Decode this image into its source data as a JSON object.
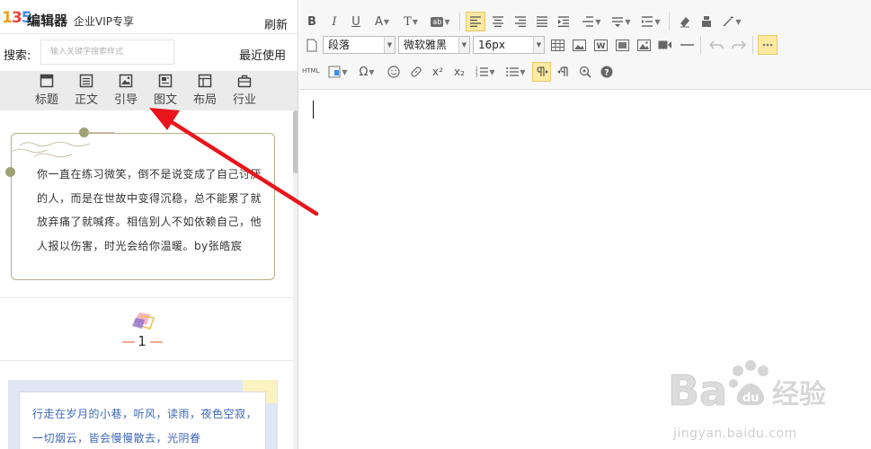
{
  "app": {
    "logo_digits": [
      "1",
      "3",
      "5"
    ],
    "title": "编辑器",
    "edition": "企业VIP专享",
    "refresh": "刷新"
  },
  "search": {
    "label": "搜索:",
    "placeholder": "输入关键字搜索样式",
    "recent": "最近使用"
  },
  "categories": [
    {
      "label": "标题",
      "icon": "title-icon"
    },
    {
      "label": "正文",
      "icon": "body-text-icon"
    },
    {
      "label": "引导",
      "icon": "image-guide-icon"
    },
    {
      "label": "图文",
      "icon": "image-text-icon"
    },
    {
      "label": "布局",
      "icon": "layout-icon"
    },
    {
      "label": "行业",
      "icon": "industry-icon"
    }
  ],
  "templates": {
    "card1_text": "你一直在练习微笑，倒不是说变成了自己讨厌的人，而是在世故中变得沉稳，总不能累了就放弃痛了就喊疼。相信别人不如依赖自己，他人报以伤害，时光会给你温暖。by张皓宸",
    "page_number": "1",
    "card2_text": "行走在岁月的小巷，听风，读雨，夜色空寂，一切烟云，皆会慢慢散去，光阴眷"
  },
  "toolbar": {
    "paragraph": "段落",
    "font": "微软雅黑",
    "size": "16px",
    "html_label": "HTML",
    "omega": "Ω",
    "sup": "x²",
    "sub": "x₂"
  },
  "watermark": {
    "brand": "Baidu",
    "product": "经验",
    "url": "jingyan.baidu.com"
  },
  "colors": {
    "accent_highlight": "#fdeaa0",
    "arrow": "#e8161c",
    "card1_border": "#b7ad88",
    "card2_text": "#3d67b7"
  }
}
